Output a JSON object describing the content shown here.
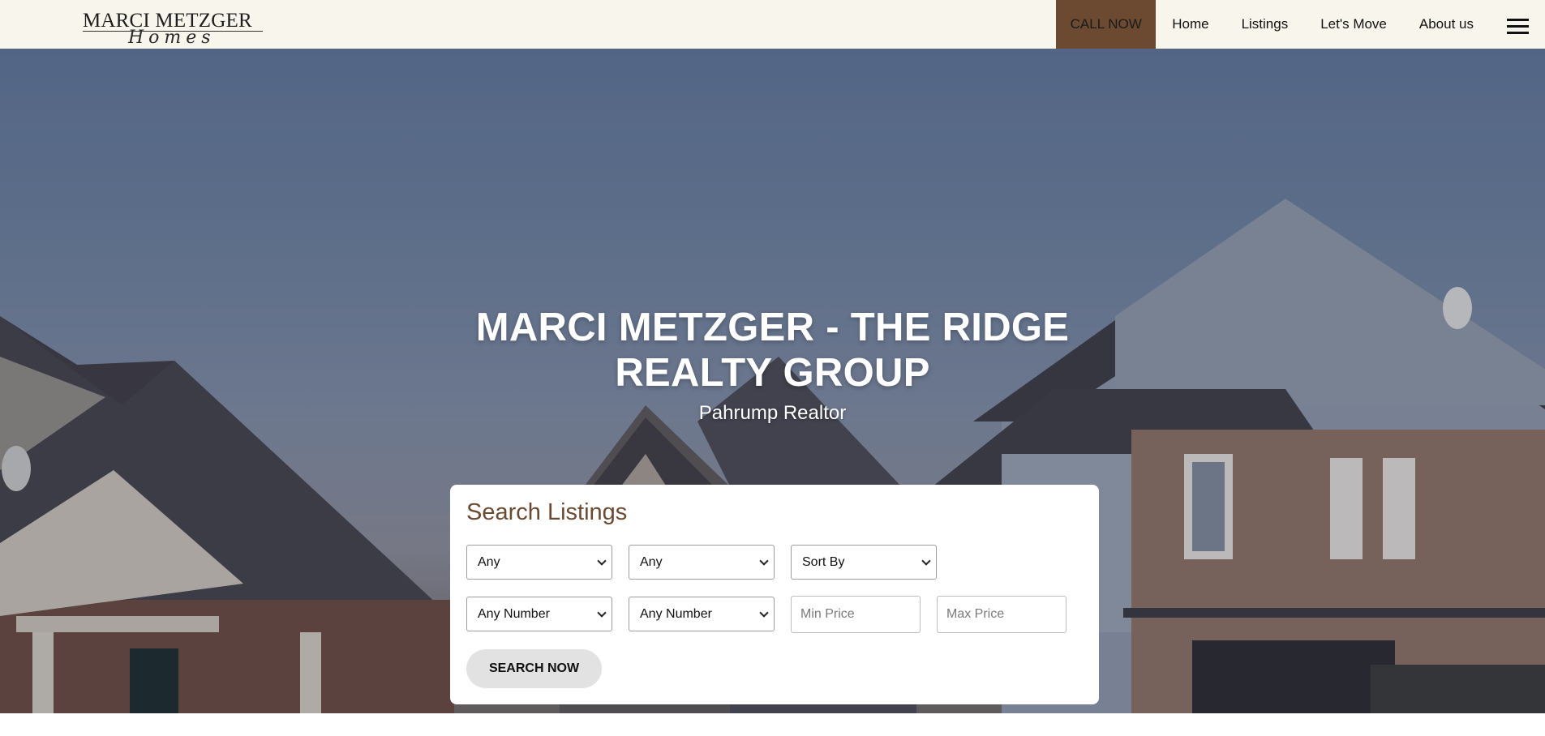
{
  "header": {
    "logo_main": "MARCI METZGER",
    "logo_script": "Homes",
    "nav": {
      "call_now": "CALL NOW",
      "home": "Home",
      "listings": "Listings",
      "lets_move": "Let's Move",
      "about_us": "About us"
    },
    "menu_icon": "hamburger-menu-icon"
  },
  "hero": {
    "title": "MARCI METZGER - THE RIDGE REALTY GROUP",
    "subtitle": "Pahrump Realtor"
  },
  "search": {
    "title": "Search Listings",
    "select_1": "Any",
    "select_2": "Any",
    "sort_by": "Sort By",
    "select_4": "Any Number",
    "select_5": "Any Number",
    "min_price_placeholder": "Min Price",
    "max_price_placeholder": "Max Price",
    "button": "SEARCH NOW"
  },
  "colors": {
    "header_bg": "#f8f5ec",
    "call_now_bg": "#6c4a31",
    "search_title": "#6b4a32",
    "button_bg": "#e2e2e2"
  }
}
